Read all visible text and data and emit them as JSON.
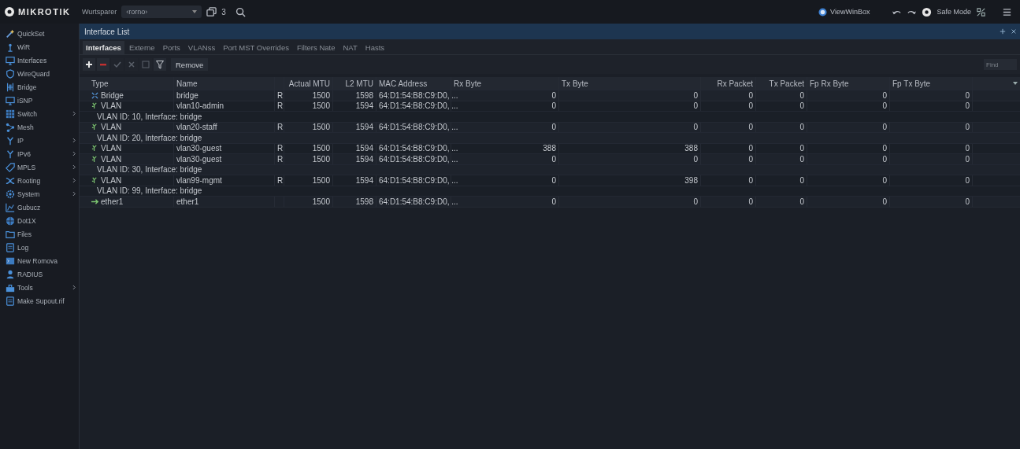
{
  "top_bar": {
    "logo": "MIKROTIK",
    "workspace_label": "Wurtsparer",
    "workspace_value": "‹rorno›",
    "windows_count": "3",
    "view_winbox": "ViewWinBox",
    "safe_mode": {
      "label": "Safe Mode",
      "on": false
    }
  },
  "sidebar": {
    "items": [
      {
        "label": "QuickSet",
        "submenu": false
      },
      {
        "label": "WiR",
        "submenu": false
      },
      {
        "label": "Interfaces",
        "submenu": false
      },
      {
        "label": "WireQuard",
        "submenu": false
      },
      {
        "label": "Bridge",
        "submenu": false
      },
      {
        "label": "iSNP",
        "submenu": false
      },
      {
        "label": "Switch",
        "submenu": true
      },
      {
        "label": "Mesh",
        "submenu": false
      },
      {
        "label": "IP",
        "submenu": true
      },
      {
        "label": "IPv6",
        "submenu": true
      },
      {
        "label": "MPLS",
        "submenu": true
      },
      {
        "label": "Rooting",
        "submenu": true
      },
      {
        "label": "System",
        "submenu": true
      },
      {
        "label": "Gubucz",
        "submenu": false
      },
      {
        "label": "Dot1X",
        "submenu": false
      },
      {
        "label": "Files",
        "submenu": false
      },
      {
        "label": "Log",
        "submenu": false
      },
      {
        "label": "New Romova",
        "submenu": false
      },
      {
        "label": "RADIUS",
        "submenu": false
      },
      {
        "label": "Tools",
        "submenu": true
      },
      {
        "label": "Make Supout.rif",
        "submenu": false
      }
    ]
  },
  "window": {
    "title": "Interface List",
    "tabs": [
      {
        "label": "Interfaces",
        "selected": true
      },
      {
        "label": "Externe",
        "selected": false
      },
      {
        "label": "Ports",
        "selected": false
      },
      {
        "label": "VLANss",
        "selected": false
      },
      {
        "label": "Port MST Overrides",
        "selected": false
      },
      {
        "label": "Filters Nate",
        "selected": false
      },
      {
        "label": "NAT",
        "selected": false
      },
      {
        "label": "Hasts",
        "selected": false
      }
    ],
    "toolbar": {
      "tools": [
        {
          "kind": "add",
          "disabled": false
        },
        {
          "kind": "remove",
          "disabled": false
        },
        {
          "kind": "enable",
          "disabled": true
        },
        {
          "kind": "disable",
          "disabled": true
        },
        {
          "kind": "comment",
          "disabled": true
        },
        {
          "kind": "filter",
          "disabled": false
        }
      ],
      "remove_label": "Remove",
      "find_placeholder": "Find"
    },
    "table": {
      "columns": [
        "Type",
        "Name",
        "",
        "Actual MTU",
        "L2 MTU",
        "MAC Address",
        "Rx Byte",
        "Tx Byte",
        "Rx Packet",
        "Tx Packet",
        "Fp Rx Byte",
        "Fp Tx Byte"
      ],
      "rows": [
        {
          "kind": "bridge",
          "type": "Bridge",
          "name": "bridge",
          "flag": "R",
          "actual_mtu": "1500",
          "l2_mtu": "1598",
          "mac": "64:D1:54:B8:C9:D0, ...",
          "rx_byte": "0",
          "tx_byte": "0",
          "rx_packet": "0",
          "tx_packet": "0",
          "fp_rx_byte": "0",
          "fp_tx_byte": "0"
        },
        {
          "kind": "vlan",
          "type": "VLAN",
          "name": "vlan10-admin",
          "flag": "R",
          "actual_mtu": "1500",
          "l2_mtu": "1594",
          "mac": "64:D1:54:B8:C9:D0, ...",
          "rx_byte": "0",
          "tx_byte": "0",
          "rx_packet": "0",
          "tx_packet": "0",
          "fp_rx_byte": "0",
          "fp_tx_byte": "0",
          "comment": "VLAN ID: 10, Interface: bridge"
        },
        {
          "kind": "vlan",
          "type": "VLAN",
          "name": "vlan20-staff",
          "flag": "R",
          "actual_mtu": "1500",
          "l2_mtu": "1594",
          "mac": "64:D1:54:B8:C9:D0, ...",
          "rx_byte": "0",
          "tx_byte": "0",
          "rx_packet": "0",
          "tx_packet": "0",
          "fp_rx_byte": "0",
          "fp_tx_byte": "0",
          "comment": "VLAN ID: 20, Interface: bridge"
        },
        {
          "kind": "vlan",
          "type": "VLAN",
          "name": "vlan30-guest",
          "flag": "R",
          "actual_mtu": "1500",
          "l2_mtu": "1594",
          "mac": "64:D1:54:B8:C9:D0, ...",
          "rx_byte": "388",
          "tx_byte": "388",
          "rx_packet": "0",
          "tx_packet": "0",
          "fp_rx_byte": "0",
          "fp_tx_byte": "0"
        },
        {
          "kind": "vlan",
          "type": "VLAN",
          "name": "vlan30-guest",
          "flag": "R",
          "actual_mtu": "1500",
          "l2_mtu": "1594",
          "mac": "64:D1:54:B8:C9:D0, ...",
          "rx_byte": "0",
          "tx_byte": "0",
          "rx_packet": "0",
          "tx_packet": "0",
          "fp_rx_byte": "0",
          "fp_tx_byte": "0",
          "comment": "VLAN ID: 30, Interface: bridge"
        },
        {
          "kind": "vlan",
          "type": "VLAN",
          "name": "vlan99-mgmt",
          "flag": "R",
          "actual_mtu": "1500",
          "l2_mtu": "1594",
          "mac": "64:D1:54:B8:C9:D0, ...",
          "rx_byte": "0",
          "tx_byte": "398",
          "rx_packet": "0",
          "tx_packet": "0",
          "fp_rx_byte": "0",
          "fp_tx_byte": "0",
          "comment": "VLAN ID: 99, Interface: bridge"
        },
        {
          "kind": "ether",
          "type": "ether1",
          "name": "ether1",
          "actual_mtu": "1500",
          "l2_mtu": "1598",
          "mac": "64:D1:54:B8:C9:D0, ...",
          "rx_byte": "0",
          "tx_byte": "0",
          "rx_packet": "0",
          "tx_packet": "0",
          "fp_rx_byte": "0",
          "fp_tx_byte": "0"
        }
      ]
    }
  }
}
